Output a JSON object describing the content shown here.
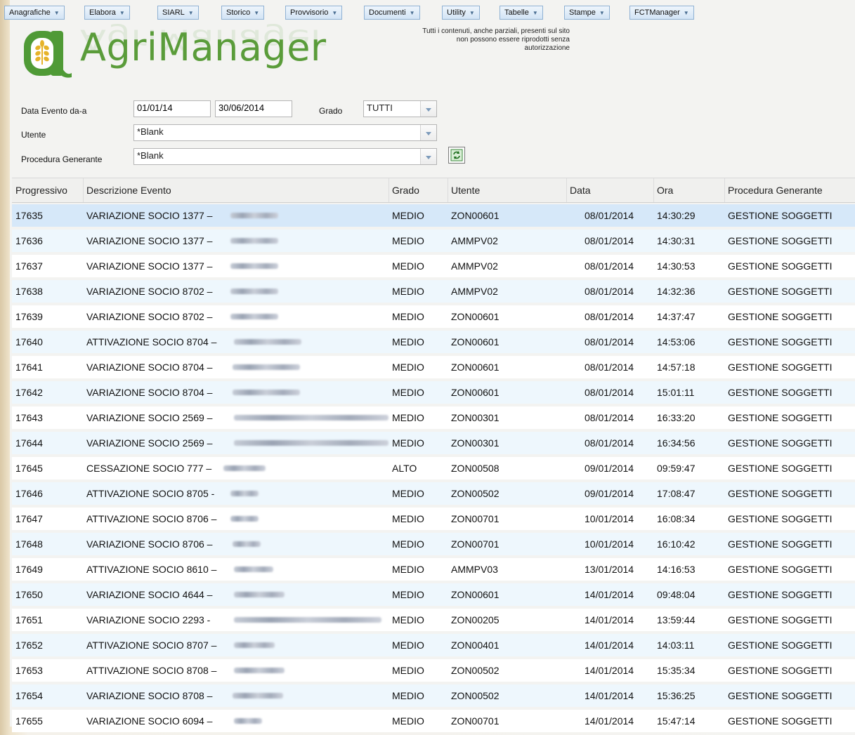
{
  "menu": [
    {
      "label": "Anagrafiche"
    },
    {
      "label": "Elabora"
    },
    {
      "label": "SIARL"
    },
    {
      "label": "Storico"
    },
    {
      "label": "Provvisorio"
    },
    {
      "label": "Documenti"
    },
    {
      "label": "Utility"
    },
    {
      "label": "Tabelle"
    },
    {
      "label": "Stampe"
    },
    {
      "label": "FCTManager"
    }
  ],
  "logo": {
    "text": "AgriManager"
  },
  "copyright": {
    "line1": "Tutti i contenuti, anche parziali, presenti sul sito",
    "line2": "non possono essere riprodotti senza",
    "line3": "autorizzazione"
  },
  "filters": {
    "date_label": "Data Evento da-a",
    "date_from": "01/01/14",
    "date_to": "30/06/2014",
    "grado_label": "Grado",
    "grado_value": "TUTTI",
    "utente_label": "Utente",
    "utente_value": "*Blank",
    "procedura_label": "Procedura Generante",
    "procedura_value": "*Blank"
  },
  "colors": {
    "accent": "#5a9c3a",
    "selected_row": "#d6e8f9",
    "alt_row": "#eef7fd"
  },
  "table": {
    "headers": {
      "progressivo": "Progressivo",
      "descrizione": "Descrizione Evento",
      "grado": "Grado",
      "utente": "Utente",
      "data": "Data",
      "ora": "Ora",
      "procedura": "Procedura Generante"
    },
    "rows": [
      {
        "prog": "17635",
        "desc": "VARIAZIONE SOCIO 1377 –",
        "grado": "MEDIO",
        "utente": "ZON00601",
        "data": "08/01/2014",
        "ora": "14:30:29",
        "proc": "GESTIONE SOGGETTI"
      },
      {
        "prog": "17636",
        "desc": "VARIAZIONE SOCIO 1377 –",
        "grado": "MEDIO",
        "utente": "AMMPV02",
        "data": "08/01/2014",
        "ora": "14:30:31",
        "proc": "GESTIONE SOGGETTI"
      },
      {
        "prog": "17637",
        "desc": "VARIAZIONE SOCIO 1377 –",
        "grado": "MEDIO",
        "utente": "AMMPV02",
        "data": "08/01/2014",
        "ora": "14:30:53",
        "proc": "GESTIONE SOGGETTI"
      },
      {
        "prog": "17638",
        "desc": "VARIAZIONE SOCIO 8702 –",
        "grado": "MEDIO",
        "utente": "AMMPV02",
        "data": "08/01/2014",
        "ora": "14:32:36",
        "proc": "GESTIONE SOGGETTI"
      },
      {
        "prog": "17639",
        "desc": "VARIAZIONE SOCIO 8702 –",
        "grado": "MEDIO",
        "utente": "ZON00601",
        "data": "08/01/2014",
        "ora": "14:37:47",
        "proc": "GESTIONE SOGGETTI"
      },
      {
        "prog": "17640",
        "desc": "ATTIVAZIONE SOCIO 8704 –",
        "grado": "MEDIO",
        "utente": "ZON00601",
        "data": "08/01/2014",
        "ora": "14:53:06",
        "proc": "GESTIONE SOGGETTI"
      },
      {
        "prog": "17641",
        "desc": "VARIAZIONE SOCIO 8704 –",
        "grado": "MEDIO",
        "utente": "ZON00601",
        "data": "08/01/2014",
        "ora": "14:57:18",
        "proc": "GESTIONE SOGGETTI"
      },
      {
        "prog": "17642",
        "desc": "VARIAZIONE SOCIO 8704 –",
        "grado": "MEDIO",
        "utente": "ZON00601",
        "data": "08/01/2014",
        "ora": "15:01:11",
        "proc": "GESTIONE SOGGETTI"
      },
      {
        "prog": "17643",
        "desc": "VARIAZIONE SOCIO 2569 –",
        "grado": "MEDIO",
        "utente": "ZON00301",
        "data": "08/01/2014",
        "ora": "16:33:20",
        "proc": "GESTIONE SOGGETTI"
      },
      {
        "prog": "17644",
        "desc": "VARIAZIONE SOCIO 2569 –",
        "grado": "MEDIO",
        "utente": "ZON00301",
        "data": "08/01/2014",
        "ora": "16:34:56",
        "proc": "GESTIONE SOGGETTI"
      },
      {
        "prog": "17645",
        "desc": "CESSAZIONE SOCIO 777 –",
        "grado": "ALTO",
        "utente": "ZON00508",
        "data": "09/01/2014",
        "ora": "09:59:47",
        "proc": "GESTIONE SOGGETTI"
      },
      {
        "prog": "17646",
        "desc": "ATTIVAZIONE SOCIO 8705 -",
        "grado": "MEDIO",
        "utente": "ZON00502",
        "data": "09/01/2014",
        "ora": "17:08:47",
        "proc": "GESTIONE SOGGETTI"
      },
      {
        "prog": "17647",
        "desc": "ATTIVAZIONE SOCIO 8706 –",
        "grado": "MEDIO",
        "utente": "ZON00701",
        "data": "10/01/2014",
        "ora": "16:08:34",
        "proc": "GESTIONE SOGGETTI"
      },
      {
        "prog": "17648",
        "desc": "VARIAZIONE SOCIO 8706 –",
        "grado": "MEDIO",
        "utente": "ZON00701",
        "data": "10/01/2014",
        "ora": "16:10:42",
        "proc": "GESTIONE SOGGETTI"
      },
      {
        "prog": "17649",
        "desc": "ATTIVAZIONE SOCIO 8610 –",
        "grado": "MEDIO",
        "utente": "AMMPV03",
        "data": "13/01/2014",
        "ora": "14:16:53",
        "proc": "GESTIONE SOGGETTI"
      },
      {
        "prog": "17650",
        "desc": "VARIAZIONE SOCIO 4644 –",
        "grado": "MEDIO",
        "utente": "ZON00601",
        "data": "14/01/2014",
        "ora": "09:48:04",
        "proc": "GESTIONE SOGGETTI"
      },
      {
        "prog": "17651",
        "desc": "VARIAZIONE SOCIO 2293 -",
        "grado": "MEDIO",
        "utente": "ZON00205",
        "data": "14/01/2014",
        "ora": "13:59:44",
        "proc": "GESTIONE SOGGETTI"
      },
      {
        "prog": "17652",
        "desc": "ATTIVAZIONE SOCIO 8707 –",
        "grado": "MEDIO",
        "utente": "ZON00401",
        "data": "14/01/2014",
        "ora": "14:03:11",
        "proc": "GESTIONE SOGGETTI"
      },
      {
        "prog": "17653",
        "desc": "ATTIVAZIONE SOCIO 8708 –",
        "grado": "MEDIO",
        "utente": "ZON00502",
        "data": "14/01/2014",
        "ora": "15:35:34",
        "proc": "GESTIONE SOGGETTI"
      },
      {
        "prog": "17654",
        "desc": "VARIAZIONE SOCIO 8708 –",
        "grado": "MEDIO",
        "utente": "ZON00502",
        "data": "14/01/2014",
        "ora": "15:36:25",
        "proc": "GESTIONE SOGGETTI"
      },
      {
        "prog": "17655",
        "desc": "VARIAZIONE SOCIO 6094 –",
        "grado": "MEDIO",
        "utente": "ZON00701",
        "data": "14/01/2014",
        "ora": "15:47:14",
        "proc": "GESTIONE SOGGETTI"
      }
    ]
  }
}
